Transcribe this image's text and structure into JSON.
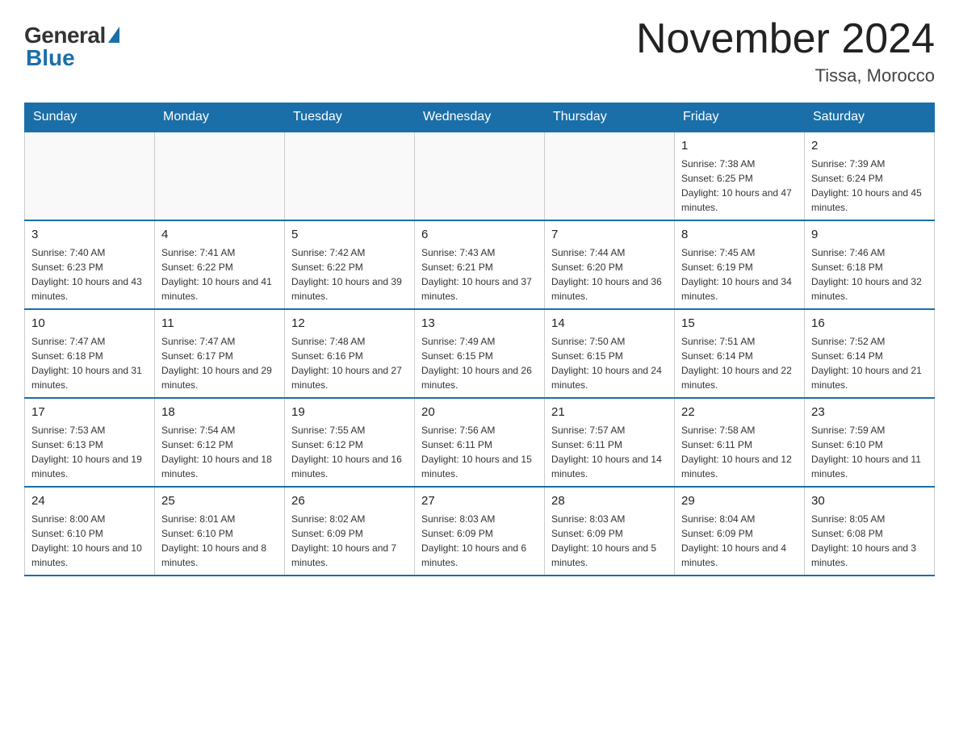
{
  "header": {
    "logo": {
      "general": "General",
      "blue": "Blue"
    },
    "title": "November 2024",
    "location": "Tissa, Morocco"
  },
  "days_of_week": [
    "Sunday",
    "Monday",
    "Tuesday",
    "Wednesday",
    "Thursday",
    "Friday",
    "Saturday"
  ],
  "weeks": [
    [
      {
        "day": "",
        "info": ""
      },
      {
        "day": "",
        "info": ""
      },
      {
        "day": "",
        "info": ""
      },
      {
        "day": "",
        "info": ""
      },
      {
        "day": "",
        "info": ""
      },
      {
        "day": "1",
        "info": "Sunrise: 7:38 AM\nSunset: 6:25 PM\nDaylight: 10 hours and 47 minutes."
      },
      {
        "day": "2",
        "info": "Sunrise: 7:39 AM\nSunset: 6:24 PM\nDaylight: 10 hours and 45 minutes."
      }
    ],
    [
      {
        "day": "3",
        "info": "Sunrise: 7:40 AM\nSunset: 6:23 PM\nDaylight: 10 hours and 43 minutes."
      },
      {
        "day": "4",
        "info": "Sunrise: 7:41 AM\nSunset: 6:22 PM\nDaylight: 10 hours and 41 minutes."
      },
      {
        "day": "5",
        "info": "Sunrise: 7:42 AM\nSunset: 6:22 PM\nDaylight: 10 hours and 39 minutes."
      },
      {
        "day": "6",
        "info": "Sunrise: 7:43 AM\nSunset: 6:21 PM\nDaylight: 10 hours and 37 minutes."
      },
      {
        "day": "7",
        "info": "Sunrise: 7:44 AM\nSunset: 6:20 PM\nDaylight: 10 hours and 36 minutes."
      },
      {
        "day": "8",
        "info": "Sunrise: 7:45 AM\nSunset: 6:19 PM\nDaylight: 10 hours and 34 minutes."
      },
      {
        "day": "9",
        "info": "Sunrise: 7:46 AM\nSunset: 6:18 PM\nDaylight: 10 hours and 32 minutes."
      }
    ],
    [
      {
        "day": "10",
        "info": "Sunrise: 7:47 AM\nSunset: 6:18 PM\nDaylight: 10 hours and 31 minutes."
      },
      {
        "day": "11",
        "info": "Sunrise: 7:47 AM\nSunset: 6:17 PM\nDaylight: 10 hours and 29 minutes."
      },
      {
        "day": "12",
        "info": "Sunrise: 7:48 AM\nSunset: 6:16 PM\nDaylight: 10 hours and 27 minutes."
      },
      {
        "day": "13",
        "info": "Sunrise: 7:49 AM\nSunset: 6:15 PM\nDaylight: 10 hours and 26 minutes."
      },
      {
        "day": "14",
        "info": "Sunrise: 7:50 AM\nSunset: 6:15 PM\nDaylight: 10 hours and 24 minutes."
      },
      {
        "day": "15",
        "info": "Sunrise: 7:51 AM\nSunset: 6:14 PM\nDaylight: 10 hours and 22 minutes."
      },
      {
        "day": "16",
        "info": "Sunrise: 7:52 AM\nSunset: 6:14 PM\nDaylight: 10 hours and 21 minutes."
      }
    ],
    [
      {
        "day": "17",
        "info": "Sunrise: 7:53 AM\nSunset: 6:13 PM\nDaylight: 10 hours and 19 minutes."
      },
      {
        "day": "18",
        "info": "Sunrise: 7:54 AM\nSunset: 6:12 PM\nDaylight: 10 hours and 18 minutes."
      },
      {
        "day": "19",
        "info": "Sunrise: 7:55 AM\nSunset: 6:12 PM\nDaylight: 10 hours and 16 minutes."
      },
      {
        "day": "20",
        "info": "Sunrise: 7:56 AM\nSunset: 6:11 PM\nDaylight: 10 hours and 15 minutes."
      },
      {
        "day": "21",
        "info": "Sunrise: 7:57 AM\nSunset: 6:11 PM\nDaylight: 10 hours and 14 minutes."
      },
      {
        "day": "22",
        "info": "Sunrise: 7:58 AM\nSunset: 6:11 PM\nDaylight: 10 hours and 12 minutes."
      },
      {
        "day": "23",
        "info": "Sunrise: 7:59 AM\nSunset: 6:10 PM\nDaylight: 10 hours and 11 minutes."
      }
    ],
    [
      {
        "day": "24",
        "info": "Sunrise: 8:00 AM\nSunset: 6:10 PM\nDaylight: 10 hours and 10 minutes."
      },
      {
        "day": "25",
        "info": "Sunrise: 8:01 AM\nSunset: 6:10 PM\nDaylight: 10 hours and 8 minutes."
      },
      {
        "day": "26",
        "info": "Sunrise: 8:02 AM\nSunset: 6:09 PM\nDaylight: 10 hours and 7 minutes."
      },
      {
        "day": "27",
        "info": "Sunrise: 8:03 AM\nSunset: 6:09 PM\nDaylight: 10 hours and 6 minutes."
      },
      {
        "day": "28",
        "info": "Sunrise: 8:03 AM\nSunset: 6:09 PM\nDaylight: 10 hours and 5 minutes."
      },
      {
        "day": "29",
        "info": "Sunrise: 8:04 AM\nSunset: 6:09 PM\nDaylight: 10 hours and 4 minutes."
      },
      {
        "day": "30",
        "info": "Sunrise: 8:05 AM\nSunset: 6:08 PM\nDaylight: 10 hours and 3 minutes."
      }
    ]
  ]
}
